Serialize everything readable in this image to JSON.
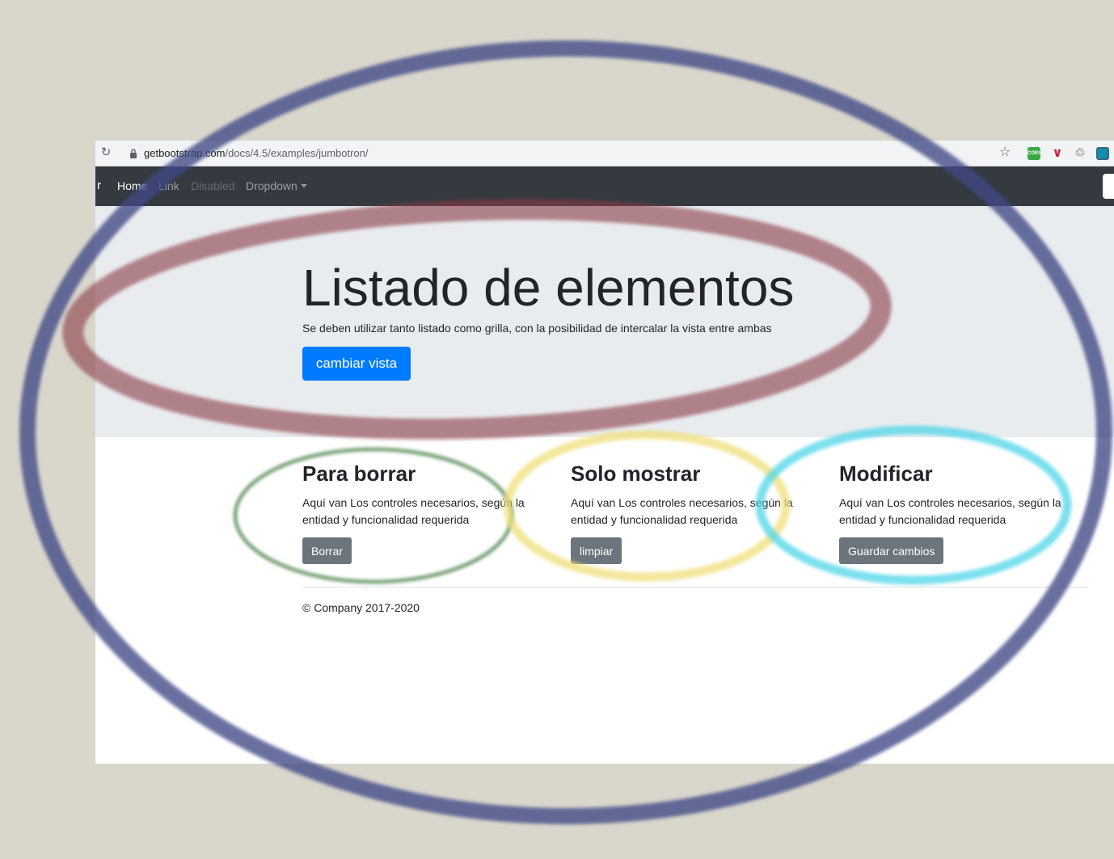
{
  "browser": {
    "url_host": "getbootstrap.com",
    "url_path": "/docs/4.5/examples/jumbotron/",
    "extension_cors_label": "CORS"
  },
  "navbar": {
    "brand_tail": "r",
    "items": [
      {
        "label": "Home"
      },
      {
        "label": "Link"
      },
      {
        "label": "Disabled"
      },
      {
        "label": "Dropdown"
      }
    ]
  },
  "jumbotron": {
    "title": "Listado de elementos",
    "lead": "Se deben utilizar tanto listado como grilla, con la posibilidad de intercalar la vista entre ambas",
    "button_label": "cambiar vista"
  },
  "columns": [
    {
      "heading": "Para borrar",
      "text": "Aquí van Los controles necesarios, según la entidad y funcionalidad requerida",
      "button_label": "Borrar"
    },
    {
      "heading": "Solo mostrar",
      "text": "Aquí van Los controles necesarios, según la entidad y funcionalidad requerida",
      "button_label": "limpiar"
    },
    {
      "heading": "Modificar",
      "text": "Aquí van Los controles necesarios, según la entidad y funcionalidad requerida",
      "button_label": "Guardar cambios"
    }
  ],
  "footer": {
    "text": "© Company 2017-2020"
  },
  "annotation_colors": {
    "outer": "#3f4a86",
    "jumbotron": "#8a3a44",
    "column1": "#3e7a3c",
    "column2": "#f0e07a",
    "column3": "#4fd6e8"
  }
}
